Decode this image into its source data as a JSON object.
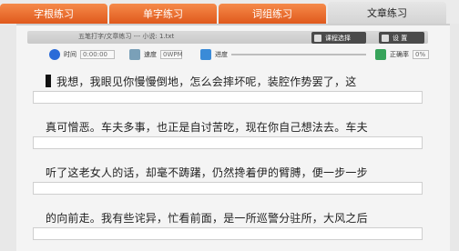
{
  "tabs": [
    {
      "label": "字根练习"
    },
    {
      "label": "单字练习"
    },
    {
      "label": "词组练习"
    },
    {
      "label": "文章练习"
    }
  ],
  "file_bar": {
    "title": "五笔打字/文章练习 --- 小说: 1.txt"
  },
  "buttons": {
    "select_course": "课程选择",
    "settings": "设 置"
  },
  "stats": {
    "time_label": "时间",
    "time_value": "0:00:00",
    "speed_label": "速度",
    "speed_value": "0WPM",
    "progress_label": "进度",
    "accuracy_label": "正确率",
    "accuracy_value": "0%"
  },
  "lines": [
    "我想，我眼见你慢慢倒地，怎么会摔坏呢，装腔作势罢了，这",
    "真可憎恶。车夫多事，也正是自讨苦吃，现在你自己想法去。车夫",
    "听了这老女人的话，却毫不踌躇，仍然搀着伊的臂膊，便一步一步",
    "的向前走。我有些诧异，忙看前面，是一所巡警分驻所，大风之后"
  ]
}
